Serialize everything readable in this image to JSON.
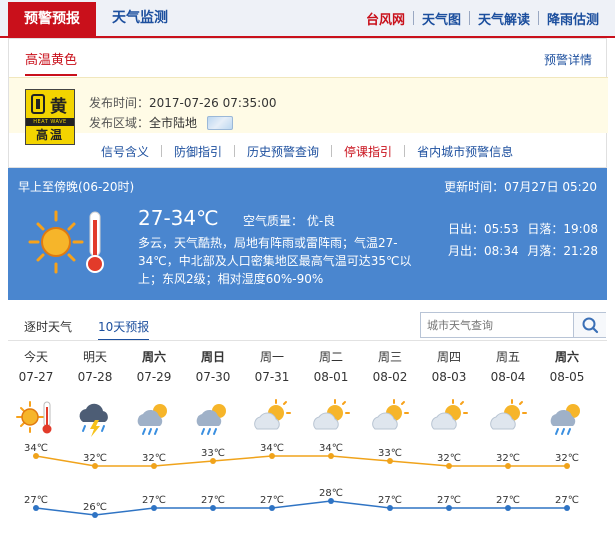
{
  "nav": {
    "warning_tab": "预警预报",
    "monitor": "天气监测",
    "links": [
      "台风网",
      "天气图",
      "天气解读",
      "降雨估测"
    ]
  },
  "warning": {
    "level_title": "高温黄色",
    "detail_link": "预警详情",
    "icon": {
      "char": "黄",
      "english": "HEAT WAVE",
      "chinese": "高温",
      "color": "#f3d400"
    },
    "publish_label": "发布时间：",
    "publish_time": "2017-07-26 07:35:00",
    "area_label": "发布区域：",
    "area": "全市陆地",
    "links": [
      "信号含义",
      "防御指引",
      "历史预警查询",
      "停课指引",
      "省内城市预警信息"
    ]
  },
  "forecast": {
    "period": "早上至傍晚(06-20时)",
    "update": "更新时间：07月27日 05:20",
    "temp": "27-34℃",
    "aqi": "空气质量： 优-良",
    "description": "多云，天气酷热，局地有阵雨或雷阵雨；气温27-34℃，中北部及人口密集地区最高气温可达35℃以上；东风2级；相对湿度60%-90%",
    "sunrise_label": "日出：",
    "sunrise": "05:53",
    "sunset_label": "日落：",
    "sunset": "19:08",
    "moonrise_label": "月出：",
    "moonrise": "08:34",
    "moonset_label": "月落：",
    "moonset": "21:28"
  },
  "tabs": [
    "逐时天气",
    "10天预报"
  ],
  "search": {
    "placeholder": "城市天气查询"
  },
  "colors": {
    "accent_red": "#c9101b",
    "link_blue": "#1c4f9e",
    "forecast_bg": "#4a86cf",
    "high_line": "#f0a31b",
    "low_line": "#2f74c4"
  },
  "days": [
    {
      "weekday": "今天",
      "date": "07-27",
      "icon": "sun-thermometer-icon",
      "high": "34℃",
      "low": "27℃"
    },
    {
      "weekday": "明天",
      "date": "07-28",
      "icon": "thunderstorm-icon",
      "high": "32℃",
      "low": "26℃"
    },
    {
      "weekday": "周六",
      "date": "07-29",
      "icon": "cloud-rain-icon",
      "high": "32℃",
      "low": "27℃"
    },
    {
      "weekday": "周日",
      "date": "07-30",
      "icon": "cloud-rain-icon",
      "high": "33℃",
      "low": "27℃"
    },
    {
      "weekday": "周一",
      "date": "07-31",
      "icon": "partly-cloudy-icon",
      "high": "34℃",
      "low": "27℃"
    },
    {
      "weekday": "周二",
      "date": "08-01",
      "icon": "partly-cloudy-icon",
      "high": "34℃",
      "low": "28℃"
    },
    {
      "weekday": "周三",
      "date": "08-02",
      "icon": "partly-cloudy-icon",
      "high": "33℃",
      "low": "27℃"
    },
    {
      "weekday": "周四",
      "date": "08-03",
      "icon": "partly-cloudy-icon",
      "high": "32℃",
      "low": "27℃"
    },
    {
      "weekday": "周五",
      "date": "08-04",
      "icon": "partly-cloudy-icon",
      "high": "32℃",
      "low": "27℃"
    },
    {
      "weekday": "周六",
      "date": "08-05",
      "icon": "cloud-rain-icon",
      "high": "32℃",
      "low": "27℃"
    }
  ],
  "chart_data": {
    "type": "line",
    "x": [
      "07-27",
      "07-28",
      "07-29",
      "07-30",
      "07-31",
      "08-01",
      "08-02",
      "08-03",
      "08-04",
      "08-05"
    ],
    "series": [
      {
        "values": [
          34,
          32,
          32,
          33,
          34,
          34,
          33,
          32,
          32,
          32
        ]
      },
      {
        "values": [
          27,
          26,
          27,
          27,
          27,
          28,
          27,
          27,
          27,
          27
        ]
      }
    ]
  }
}
